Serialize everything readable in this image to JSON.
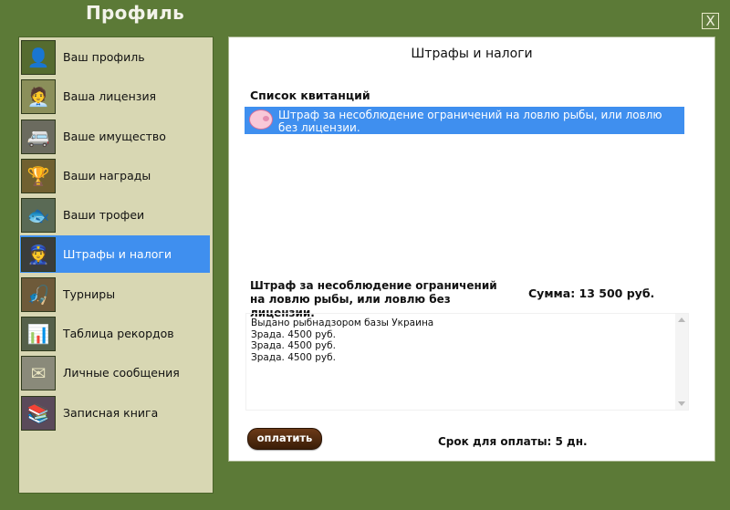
{
  "window": {
    "title": "Профиль",
    "close_label": "X"
  },
  "sidebar": {
    "items": [
      {
        "label": "Ваш профиль",
        "icon": "profile-icon",
        "glyph": "👤",
        "bg": "#556b2f",
        "active": false
      },
      {
        "label": "Ваша лицензия",
        "icon": "license-icon",
        "glyph": "🧑‍💼",
        "bg": "#8b8f5a",
        "active": false
      },
      {
        "label": "Ваше имущество",
        "icon": "property-icon",
        "glyph": "🚐",
        "bg": "#6b6b5f",
        "active": false
      },
      {
        "label": "Ваши награды",
        "icon": "awards-icon",
        "glyph": "🏆",
        "bg": "#706030",
        "active": false
      },
      {
        "label": "Ваши трофеи",
        "icon": "trophies-icon",
        "glyph": "🐟",
        "bg": "#5a6a55",
        "active": false
      },
      {
        "label": "Штрафы и налоги",
        "icon": "fines-icon",
        "glyph": "👮",
        "bg": "#3b3d3a",
        "active": true
      },
      {
        "label": "Турниры",
        "icon": "tournaments-icon",
        "glyph": "🎣",
        "bg": "#6e5a3a",
        "active": false
      },
      {
        "label": "Таблица рекордов",
        "icon": "records-icon",
        "glyph": "📊",
        "bg": "#55604a",
        "active": false
      },
      {
        "label": "Личные сообщения",
        "icon": "messages-icon",
        "glyph": "✉",
        "bg": "#8a8a7a",
        "active": false
      },
      {
        "label": "Записная книга",
        "icon": "notebook-icon",
        "glyph": "📚",
        "bg": "#5a4a5a",
        "active": false
      }
    ]
  },
  "panel": {
    "title": "Штрафы и налоги",
    "list_heading": "Список квитанций",
    "receipts": [
      {
        "text": "Штраф за несоблюдение ограничений на ловлю рыбы, или ловлю без лицензии.",
        "icon": "piggy-bank-icon"
      }
    ],
    "details": {
      "title": "Штраф за несоблюдение ограничений на ловлю рыбы, или ловлю без лицензии.",
      "amount": "Сумма: 13 500 руб.",
      "log_lines": [
        "Выдано рыбнадзором базы Украина",
        "Зрада. 4500 руб.",
        "Зрада. 4500 руб.",
        "Зрада. 4500 руб."
      ],
      "pay_button": "оплатить",
      "deadline": "Срок для оплаты: 5 дн."
    }
  },
  "colors": {
    "background": "#5c7a37",
    "sidebar": "#d8d7b3",
    "accent": "#3f8fef",
    "pay_button": "#4b2710"
  }
}
